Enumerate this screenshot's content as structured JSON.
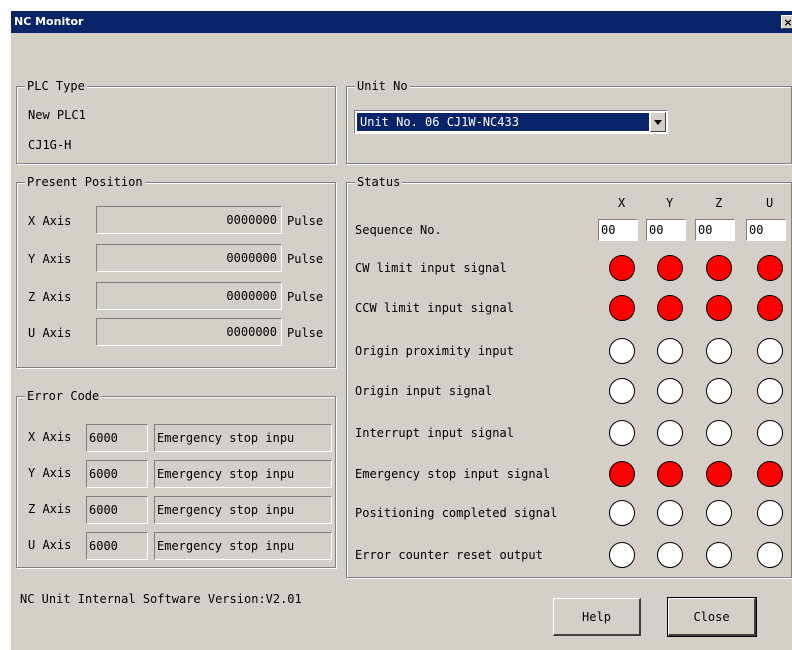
{
  "window": {
    "title": "NC Monitor",
    "close_glyph": "×"
  },
  "plc_type": {
    "legend": "PLC Type",
    "name": "New PLC1",
    "model": "CJ1G-H"
  },
  "unit_no": {
    "legend": "Unit No",
    "selected": "Unit No. 06 CJ1W-NC433"
  },
  "present_position": {
    "legend": "Present Position",
    "rows": [
      {
        "axis": "X Axis",
        "value": "0000000",
        "unit": "Pulse"
      },
      {
        "axis": "Y Axis",
        "value": "0000000",
        "unit": "Pulse"
      },
      {
        "axis": "Z Axis",
        "value": "0000000",
        "unit": "Pulse"
      },
      {
        "axis": "U Axis",
        "value": "0000000",
        "unit": "Pulse"
      }
    ]
  },
  "error_code": {
    "legend": "Error Code",
    "rows": [
      {
        "axis": "X Axis",
        "code": "6000",
        "message": "Emergency stop inpu"
      },
      {
        "axis": "Y Axis",
        "code": "6000",
        "message": "Emergency stop inpu"
      },
      {
        "axis": "Z Axis",
        "code": "6000",
        "message": "Emergency stop inpu"
      },
      {
        "axis": "U Axis",
        "code": "6000",
        "message": "Emergency stop inpu"
      }
    ]
  },
  "status": {
    "legend": "Status",
    "axes": [
      "X",
      "Y",
      "Z",
      "U"
    ],
    "sequence_label": "Sequence No.",
    "sequence_values": [
      "00",
      "00",
      "00",
      "00"
    ],
    "colors": {
      "on": "#ff0000",
      "off": "#ffffff"
    },
    "signals": [
      {
        "label": "CW limit input signal",
        "states": [
          "on",
          "on",
          "on",
          "on"
        ]
      },
      {
        "label": "CCW limit input signal",
        "states": [
          "on",
          "on",
          "on",
          "on"
        ]
      },
      {
        "label": "Origin proximity input",
        "states": [
          "off",
          "off",
          "off",
          "off"
        ]
      },
      {
        "label": "Origin input signal",
        "states": [
          "off",
          "off",
          "off",
          "off"
        ]
      },
      {
        "label": "Interrupt input signal",
        "states": [
          "off",
          "off",
          "off",
          "off"
        ]
      },
      {
        "label": "Emergency stop input signal",
        "states": [
          "on",
          "on",
          "on",
          "on"
        ]
      },
      {
        "label": "Positioning completed signal",
        "states": [
          "off",
          "off",
          "off",
          "off"
        ]
      },
      {
        "label": "Error counter reset output",
        "states": [
          "off",
          "off",
          "off",
          "off"
        ]
      }
    ]
  },
  "footer": {
    "version_text": "NC Unit Internal Software Version:V2.01",
    "help_label": "Help",
    "close_label": "Close"
  }
}
